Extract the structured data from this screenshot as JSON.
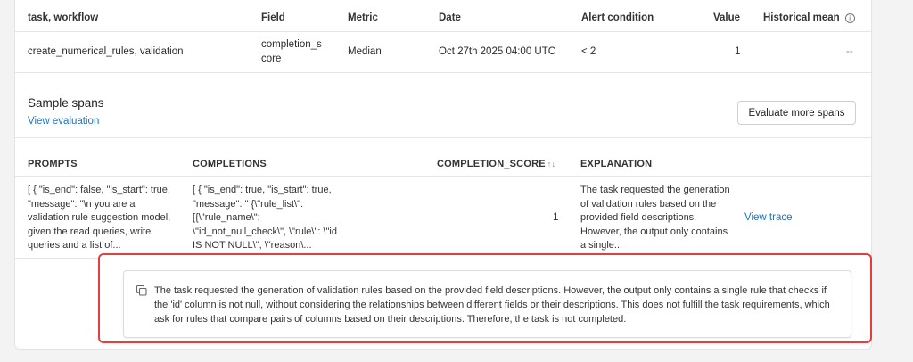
{
  "alert_table": {
    "headers": {
      "task_workflow": "task, workflow",
      "field": "Field",
      "metric": "Metric",
      "date": "Date",
      "alert_condition": "Alert condition",
      "value": "Value",
      "historical_mean": "Historical mean"
    },
    "row": {
      "task_workflow": "create_numerical_rules, validation",
      "field_line1": "completion_s",
      "field_line2": "core",
      "metric": "Median",
      "date": "Oct 27th 2025 04:00 UTC",
      "alert_condition": "< 2",
      "value": "1",
      "historical_mean": "--"
    }
  },
  "sample_spans": {
    "title": "Sample spans",
    "view_evaluation": "View evaluation",
    "evaluate_more_button": "Evaluate more spans",
    "headers": {
      "prompts": "PROMPTS",
      "completions": "COMPLETIONS",
      "completion_score": "COMPLETION_SCORE",
      "explanation": "EXPLANATION"
    },
    "row": {
      "prompt": "[ { \"is_end\": false, \"is_start\": true, \"message\": \"\\n you are a validation rule suggestion model, given the read queries, write queries and a list of...",
      "completion": "[ { \"is_end\": true, \"is_start\": true, \"message\": \" {\\\"rule_list\\\": [{\\\"rule_name\\\": \\\"id_not_null_check\\\", \\\"rule\\\": \\\"id IS NOT NULL\\\", \\\"reason\\...",
      "score": "1",
      "explanation": "The task requested the generation of validation rules based on the provided field descriptions. However, the output only contains a single...",
      "view_trace": "View trace"
    }
  },
  "popup": {
    "text": "The task requested the generation of validation rules based on the provided field descriptions. However, the output only contains a single rule that checks if the 'id' column is not null, without considering the relationships between different fields or their descriptions. This does not fulfill the task requirements, which ask for rules that compare pairs of columns based on their descriptions. Therefore, the task is not completed."
  },
  "icons": {
    "info": "info-icon",
    "sort": "sort-icon",
    "copy": "copy-icon"
  },
  "colors": {
    "link": "#1a73c9",
    "highlight_border": "#e53e3e"
  }
}
